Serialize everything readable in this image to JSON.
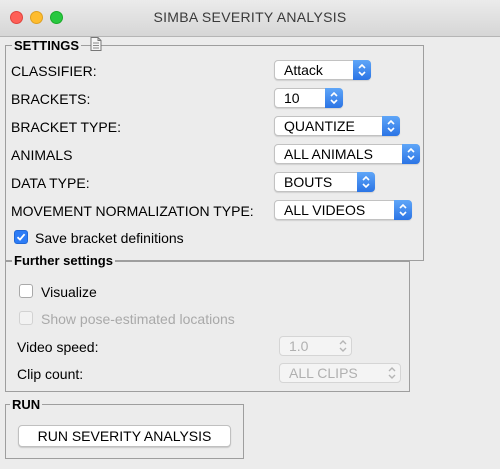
{
  "window": {
    "title": "SIMBA SEVERITY ANALYSIS",
    "controls": [
      "close",
      "minimize",
      "maximize"
    ]
  },
  "settings": {
    "title": "SETTINGS",
    "icon": "document-icon",
    "classifier": {
      "label": "CLASSIFIER:",
      "value": "Attack"
    },
    "brackets": {
      "label": "BRACKETS:",
      "value": "10"
    },
    "bracket_type": {
      "label": "BRACKET TYPE:",
      "value": "QUANTIZE"
    },
    "animals": {
      "label": "ANIMALS",
      "value": "ALL ANIMALS"
    },
    "data_type": {
      "label": "DATA TYPE:",
      "value": "BOUTS"
    },
    "movement_normalization": {
      "label": "MOVEMENT NORMALIZATION TYPE:",
      "value": "ALL VIDEOS"
    },
    "save_brackets": {
      "label": "Save bracket definitions",
      "checked": true
    }
  },
  "further": {
    "title": "Further settings",
    "visualize": {
      "label": "Visualize",
      "checked": false
    },
    "show_pose": {
      "label": "Show pose-estimated locations",
      "checked": false,
      "enabled": false
    },
    "video_speed": {
      "label": "Video speed:",
      "value": "1.0",
      "enabled": false
    },
    "clip_count": {
      "label": "Clip count:",
      "value": "ALL CLIPS",
      "enabled": false
    }
  },
  "run": {
    "title": "RUN",
    "button_label": "RUN SEVERITY ANALYSIS"
  },
  "colors": {
    "accent": "#2d7cf6",
    "window_bg": "#ececec",
    "close": "#fe5f57",
    "minimize": "#febc2e",
    "maximize": "#28c840"
  }
}
